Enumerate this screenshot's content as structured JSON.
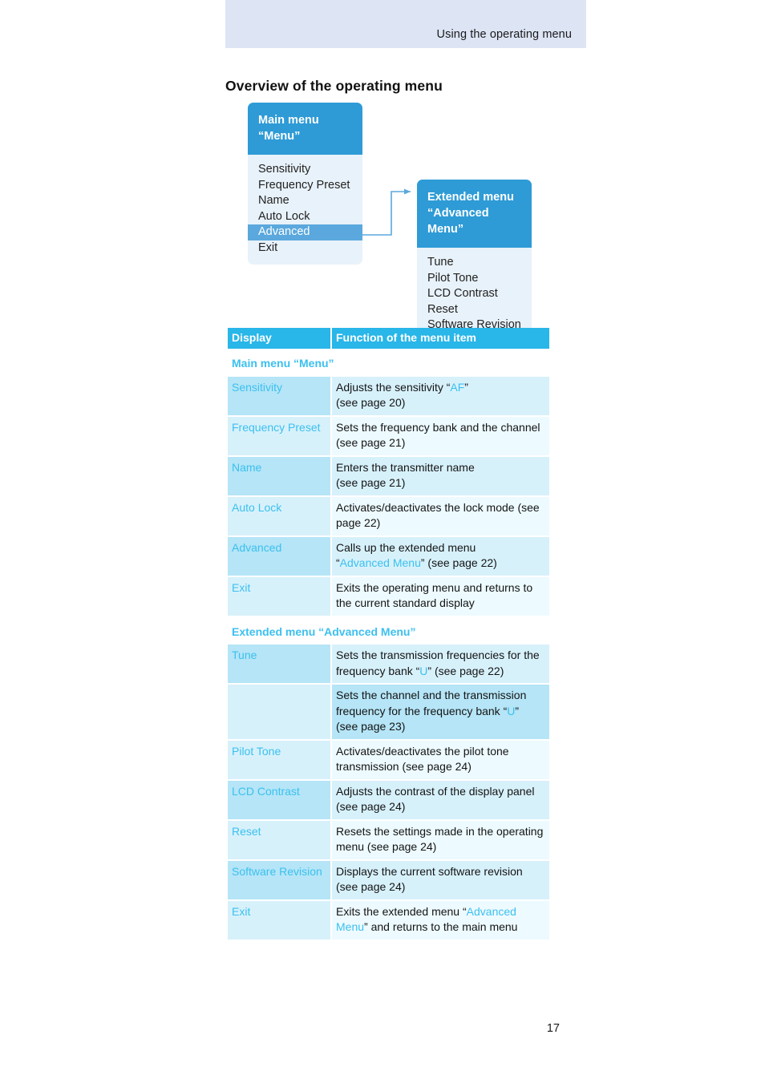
{
  "header": {
    "running_head": "Using the operating menu"
  },
  "page_title": "Overview of the operating menu",
  "page_number": "17",
  "colors": {
    "band": "#dde5f5",
    "box_header_blue": "#2e9bd6",
    "box_body_blue": "#e8f2fa",
    "selected_blue": "#5aa8dd",
    "table_header": "#29b6e8",
    "accent_cyan": "#3cc0ef",
    "row_tint_dark": "#b5e5f7",
    "row_tint_light": "#d7f1fb",
    "row_tint_lighter": "#edfaff"
  },
  "diagram": {
    "main_menu": {
      "title_line1": "Main menu",
      "title_line2": "“Menu”",
      "items": [
        {
          "label": "Sensitivity",
          "selected": false
        },
        {
          "label": "Frequency Preset",
          "selected": false
        },
        {
          "label": "Name",
          "selected": false
        },
        {
          "label": "Auto Lock",
          "selected": false
        },
        {
          "label": "Advanced",
          "selected": true
        },
        {
          "label": "Exit",
          "selected": false
        }
      ]
    },
    "extended_menu": {
      "title_line1": "Extended menu",
      "title_line2": "“Advanced Menu”",
      "items": [
        {
          "label": "Tune"
        },
        {
          "label": "Pilot Tone"
        },
        {
          "label": "LCD Contrast"
        },
        {
          "label": "Reset"
        },
        {
          "label": "Software Revision"
        }
      ]
    }
  },
  "table": {
    "columns": [
      "Display",
      "Function of the menu item"
    ],
    "sections": [
      {
        "heading": "Main menu “Menu”",
        "rows": [
          {
            "display": "Sensitivity",
            "func_parts": [
              {
                "text": "Adjusts the sensitivity “",
                "accent": false
              },
              {
                "text": "AF",
                "accent": true
              },
              {
                "text": "”",
                "accent": false
              },
              {
                "text": "\n(see page 20)",
                "accent": false
              }
            ]
          },
          {
            "display": "Frequency Preset",
            "func_parts": [
              {
                "text": "Sets the frequency bank and the channel (see page 21)",
                "accent": false
              }
            ]
          },
          {
            "display": "Name",
            "func_parts": [
              {
                "text": "Enters the transmitter name\n(see page 21)",
                "accent": false
              }
            ]
          },
          {
            "display": "Auto Lock",
            "func_parts": [
              {
                "text": "Activates/deactivates the lock mode (see page 22)",
                "accent": false
              }
            ]
          },
          {
            "display": "Advanced",
            "func_parts": [
              {
                "text": "Calls up the extended menu\n“",
                "accent": false
              },
              {
                "text": "Advanced Menu",
                "accent": true
              },
              {
                "text": "” (see page 22)",
                "accent": false
              }
            ]
          },
          {
            "display": "Exit",
            "func_parts": [
              {
                "text": "Exits the operating menu and returns to the current standard display",
                "accent": false
              }
            ]
          }
        ]
      },
      {
        "heading": "Extended menu “Advanced Menu”",
        "rows": [
          {
            "display": "Tune",
            "func_parts": [
              {
                "text": "Sets the transmission frequencies for the frequency bank “",
                "accent": false
              },
              {
                "text": "U",
                "accent": true
              },
              {
                "text": "” (see page 22)",
                "accent": false
              }
            ]
          },
          {
            "display": "",
            "subrow": true,
            "func_parts": [
              {
                "text": "Sets the channel and the transmission frequency for the frequency bank “",
                "accent": false
              },
              {
                "text": "U",
                "accent": true
              },
              {
                "text": "”\n(see page 23)",
                "accent": false
              }
            ]
          },
          {
            "display": "Pilot Tone",
            "func_parts": [
              {
                "text": "Activates/deactivates the pilot tone transmission (see page 24)",
                "accent": false
              }
            ]
          },
          {
            "display": "LCD Contrast",
            "func_parts": [
              {
                "text": "Adjusts the contrast of the display panel (see page 24)",
                "accent": false
              }
            ]
          },
          {
            "display": "Reset",
            "func_parts": [
              {
                "text": "Resets the settings made in the operating menu (see page 24)",
                "accent": false
              }
            ]
          },
          {
            "display": "Software Revision",
            "func_parts": [
              {
                "text": "Displays the current software revision (see page 24)",
                "accent": false
              }
            ]
          },
          {
            "display": "Exit",
            "func_parts": [
              {
                "text": "Exits the extended menu “",
                "accent": false
              },
              {
                "text": "Advanced Menu",
                "accent": true
              },
              {
                "text": "” and returns to the main menu",
                "accent": false
              }
            ]
          }
        ]
      }
    ]
  }
}
